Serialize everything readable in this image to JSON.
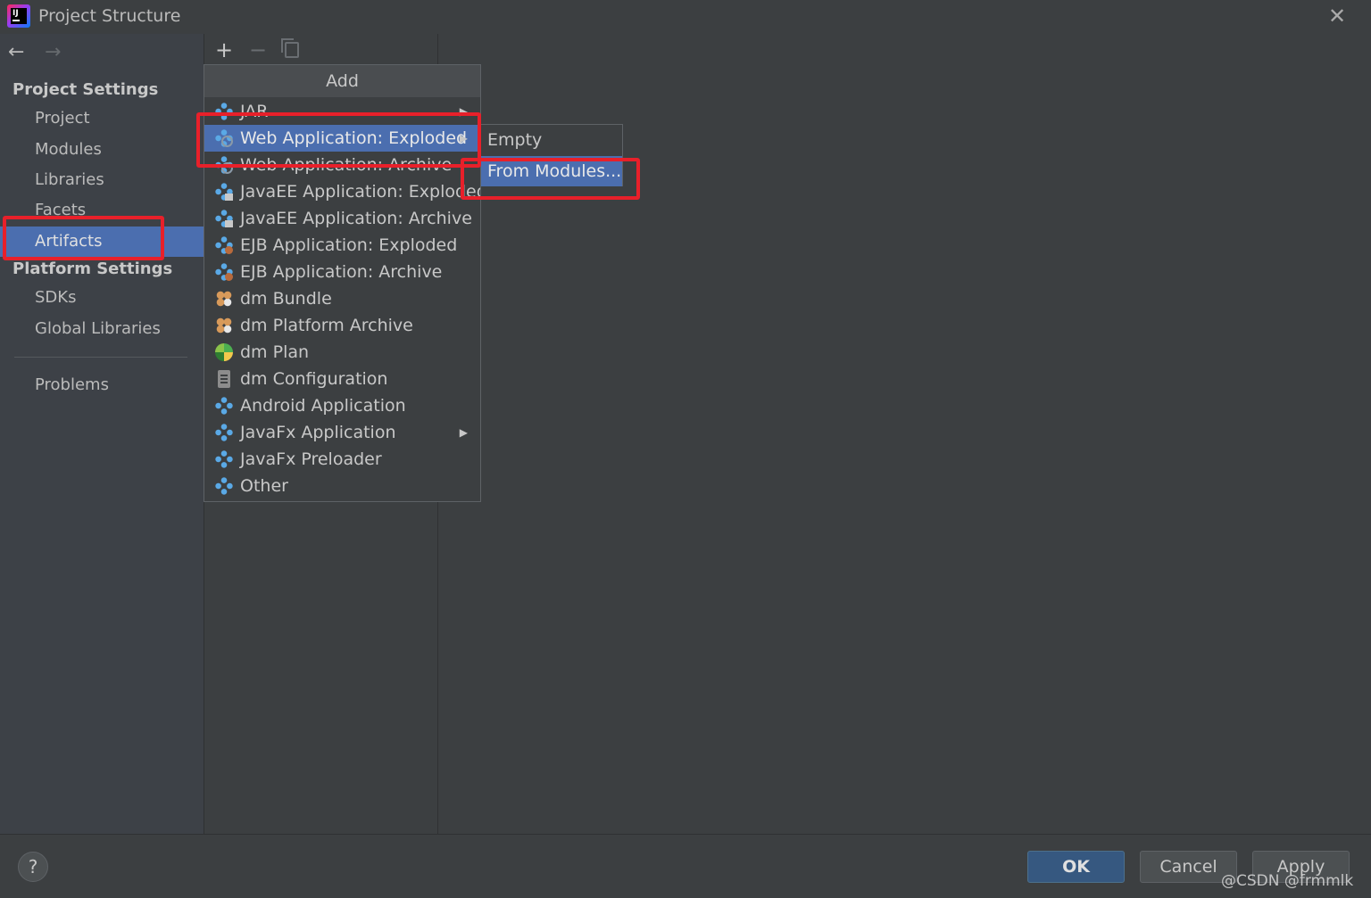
{
  "window": {
    "title": "Project Structure",
    "close_icon": "close-icon"
  },
  "sidebar": {
    "project_settings_header": "Project Settings",
    "project_items": [
      {
        "label": "Project"
      },
      {
        "label": "Modules"
      },
      {
        "label": "Libraries"
      },
      {
        "label": "Facets"
      },
      {
        "label": "Artifacts",
        "selected": true
      }
    ],
    "platform_settings_header": "Platform Settings",
    "platform_items": [
      {
        "label": "SDKs"
      },
      {
        "label": "Global Libraries"
      }
    ],
    "problems_label": "Problems"
  },
  "toolbar": {
    "add_icon": "plus-icon",
    "remove_icon": "minus-icon",
    "copy_icon": "copy-icon"
  },
  "add_popup": {
    "title": "Add",
    "items": [
      {
        "label": "JAR",
        "icon": "artifact-icon",
        "has_submenu": true
      },
      {
        "label": "Web Application: Exploded",
        "icon": "web-artifact-icon",
        "has_submenu": true,
        "highlighted": true
      },
      {
        "label": "Web Application: Archive",
        "icon": "web-artifact-icon"
      },
      {
        "label": "JavaEE Application: Exploded",
        "icon": "javaee-artifact-icon"
      },
      {
        "label": "JavaEE Application: Archive",
        "icon": "javaee-artifact-icon"
      },
      {
        "label": "EJB Application: Exploded",
        "icon": "ejb-artifact-icon"
      },
      {
        "label": "EJB Application: Archive",
        "icon": "ejb-artifact-icon"
      },
      {
        "label": "dm Bundle",
        "icon": "bundle-icon"
      },
      {
        "label": "dm Platform Archive",
        "icon": "bundle-icon"
      },
      {
        "label": "dm Plan",
        "icon": "plan-icon"
      },
      {
        "label": "dm Configuration",
        "icon": "config-file-icon"
      },
      {
        "label": "Android Application",
        "icon": "artifact-icon"
      },
      {
        "label": "JavaFx Application",
        "icon": "artifact-icon",
        "has_submenu": true
      },
      {
        "label": "JavaFx Preloader",
        "icon": "artifact-icon"
      },
      {
        "label": "Other",
        "icon": "artifact-icon"
      }
    ]
  },
  "submenu": {
    "items": [
      {
        "label": "Empty"
      },
      {
        "label": "From Modules...",
        "highlighted": true
      }
    ]
  },
  "footer": {
    "help_label": "?",
    "ok_label": "OK",
    "cancel_label": "Cancel",
    "apply_label": "Apply",
    "watermark": "@CSDN @frmmlk"
  },
  "colors": {
    "background": "#3c3f41",
    "sidebar": "#3d4147",
    "selection": "#4b6eaf",
    "annotation": "#e8202a",
    "ok_button": "#365880"
  }
}
